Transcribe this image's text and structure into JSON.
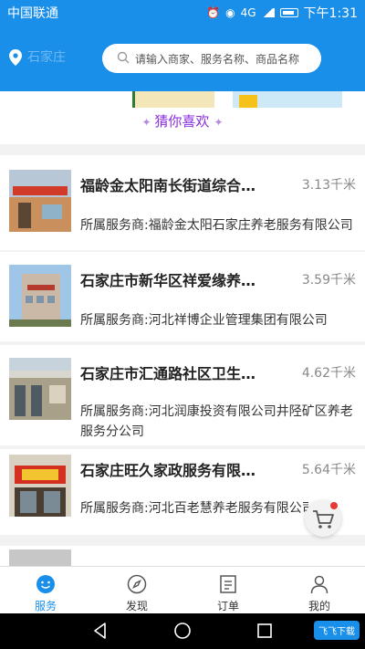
{
  "status_bar": {
    "carrier": "中国联通",
    "network": "4G",
    "time": "下午1:31"
  },
  "header": {
    "location": "石家庄",
    "search_placeholder": "请输入商家、服务名称、商品名称"
  },
  "section": {
    "title": "猜你喜欢"
  },
  "provider_prefix": "所属服务商:",
  "items": [
    {
      "title": "福龄金太阳南长街道综合…",
      "distance": "3.13千米",
      "provider": "所属服务商:福龄金太阳石家庄养老服务有限公司"
    },
    {
      "title": "石家庄市新华区祥爱缘养…",
      "distance": "3.59千米",
      "provider": "所属服务商:河北祥博企业管理集团有限公司"
    },
    {
      "title": "石家庄市汇通路社区卫生…",
      "distance": "4.62千米",
      "provider": "所属服务商:河北润康投资有限公司井陉矿区养老服务分公司"
    },
    {
      "title": "石家庄旺久家政服务有限…",
      "distance": "5.64千米",
      "provider": "所属服务商:河北百老慧养老服务有限公司"
    }
  ],
  "tabs": [
    {
      "label": "服务",
      "icon": "smile-icon",
      "active": true
    },
    {
      "label": "发现",
      "icon": "compass-icon",
      "active": false
    },
    {
      "label": "订单",
      "icon": "order-icon",
      "active": false
    },
    {
      "label": "我的",
      "icon": "user-icon",
      "active": false
    }
  ],
  "colors": {
    "brand": "#1a8fe9",
    "accent_purple": "#8a2be2",
    "badge_red": "#e53935"
  },
  "watermark": "飞飞下载"
}
